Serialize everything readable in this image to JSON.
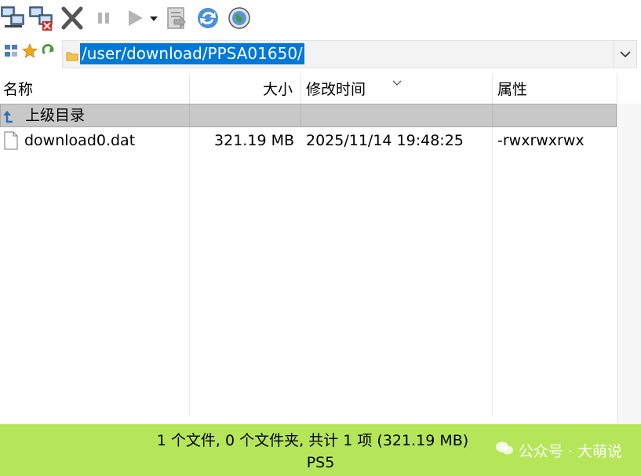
{
  "toolbar": {
    "icons": [
      "connect-icon",
      "disconnect-icon",
      "cancel-icon",
      "pause-icon",
      "play-icon",
      "play-dropdown-icon",
      "transfer-queue-icon",
      "refresh-icon",
      "web-icon"
    ]
  },
  "address": {
    "path": "/user/download/PPSA01650/"
  },
  "columns": {
    "name": "名称",
    "size": "大小",
    "modified": "修改时间",
    "attributes": "属性"
  },
  "parent_row": {
    "label": "上级目录"
  },
  "files": [
    {
      "name": "download0.dat",
      "size": "321.19 MB",
      "modified": "2025/11/14 19:48:25",
      "attributes": "-rwxrwxrwx"
    }
  ],
  "status": {
    "summary": "1 个文件, 0 个文件夹, 共计 1 项 (321.19 MB)",
    "device": "PS5"
  },
  "watermark": {
    "text": "公众号 · 大萌说"
  },
  "colors": {
    "status_bg": "#b5e65a",
    "selection": "#0078d7",
    "parent_row_bg": "#c8c8c8"
  }
}
